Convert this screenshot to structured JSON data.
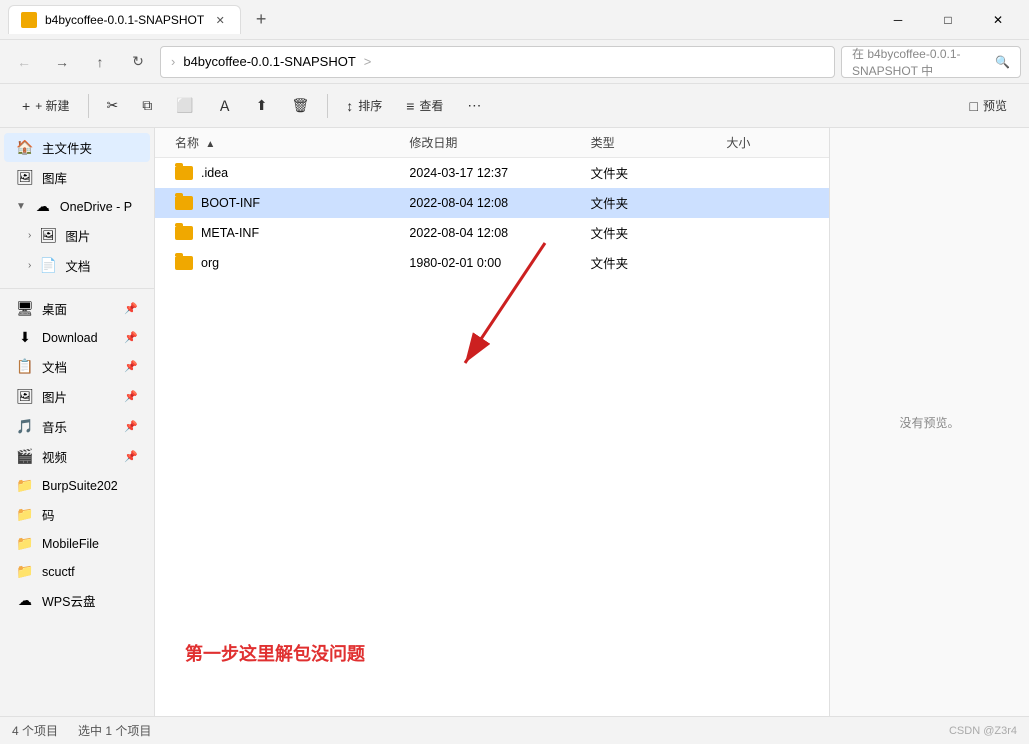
{
  "titlebar": {
    "tab_title": "b4bycoffee-0.0.1-SNAPSHOT",
    "new_tab_label": "+",
    "min_label": "─",
    "max_label": "□",
    "close_label": "✕"
  },
  "navbar": {
    "back_icon": "←",
    "forward_icon": "→",
    "up_icon": "↑",
    "refresh_icon": "↻",
    "path_root": "b4bycoffee-0.0.1-SNAPSHOT",
    "path_arrow": ">",
    "search_placeholder": "在 b4bycoffee-0.0.1-SNAPSHOT 中",
    "search_icon": "🔍"
  },
  "toolbar": {
    "new_label": "+ 新建",
    "cut_icon": "✂",
    "copy_icon": "⧉",
    "paste_icon": "⬜",
    "rename_icon": "Ａ",
    "share_icon": "⬆",
    "delete_icon": "🗑",
    "sort_label": "排序",
    "sort_icon": "↕",
    "view_label": "查看",
    "view_icon": "≡",
    "more_icon": "⋯",
    "preview_label": "预览",
    "preview_icon": "□"
  },
  "sidebar": {
    "items": [
      {
        "id": "home",
        "icon": "🏠",
        "label": "主文件夹",
        "active": true
      },
      {
        "id": "gallery",
        "icon": "🖼",
        "label": "图库"
      },
      {
        "id": "onedrive",
        "icon": "☁",
        "label": "OneDrive - P",
        "expanded": true
      },
      {
        "id": "pictures",
        "icon": "🖼",
        "label": "图片",
        "indent": true
      },
      {
        "id": "documents",
        "icon": "📄",
        "label": "文档",
        "indent": true
      },
      {
        "id": "desktop",
        "icon": "🖥",
        "label": "桌面",
        "pinned": true
      },
      {
        "id": "downloads",
        "icon": "⬇",
        "label": "Download",
        "pinned": true
      },
      {
        "id": "documents2",
        "icon": "📋",
        "label": "文档",
        "pinned": true
      },
      {
        "id": "pictures2",
        "icon": "🖼",
        "label": "图片",
        "pinned": true
      },
      {
        "id": "music",
        "icon": "🎵",
        "label": "音乐",
        "pinned": true
      },
      {
        "id": "videos",
        "icon": "🎬",
        "label": "视频",
        "pinned": true
      },
      {
        "id": "burpsuite",
        "icon": "📁",
        "label": "BurpSuite202"
      },
      {
        "id": "ma",
        "icon": "📁",
        "label": "码"
      },
      {
        "id": "mobilefile",
        "icon": "📁",
        "label": "MobileFile"
      },
      {
        "id": "scuctf",
        "icon": "📁",
        "label": "scuctf"
      },
      {
        "id": "wps",
        "icon": "☁",
        "label": "WPS云盘"
      }
    ]
  },
  "file_list": {
    "columns": {
      "name": "名称",
      "date": "修改日期",
      "type": "类型",
      "size": "大小"
    },
    "files": [
      {
        "name": ".idea",
        "date": "2024-03-17 12:37",
        "type": "文件夹",
        "size": "",
        "selected": false
      },
      {
        "name": "BOOT-INF",
        "date": "2022-08-04 12:08",
        "type": "文件夹",
        "size": "",
        "selected": true
      },
      {
        "name": "META-INF",
        "date": "2022-08-04 12:08",
        "type": "文件夹",
        "size": "",
        "selected": false
      },
      {
        "name": "org",
        "date": "1980-02-01 0:00",
        "type": "文件夹",
        "size": "",
        "selected": false
      }
    ]
  },
  "preview": {
    "no_preview_text": "没有预览。"
  },
  "status_bar": {
    "count": "4 个项目",
    "selected": "选中 1 个项目"
  },
  "annotation": {
    "text": "第一步这里解包没问题"
  },
  "watermark": "CSDN @Z3r4"
}
